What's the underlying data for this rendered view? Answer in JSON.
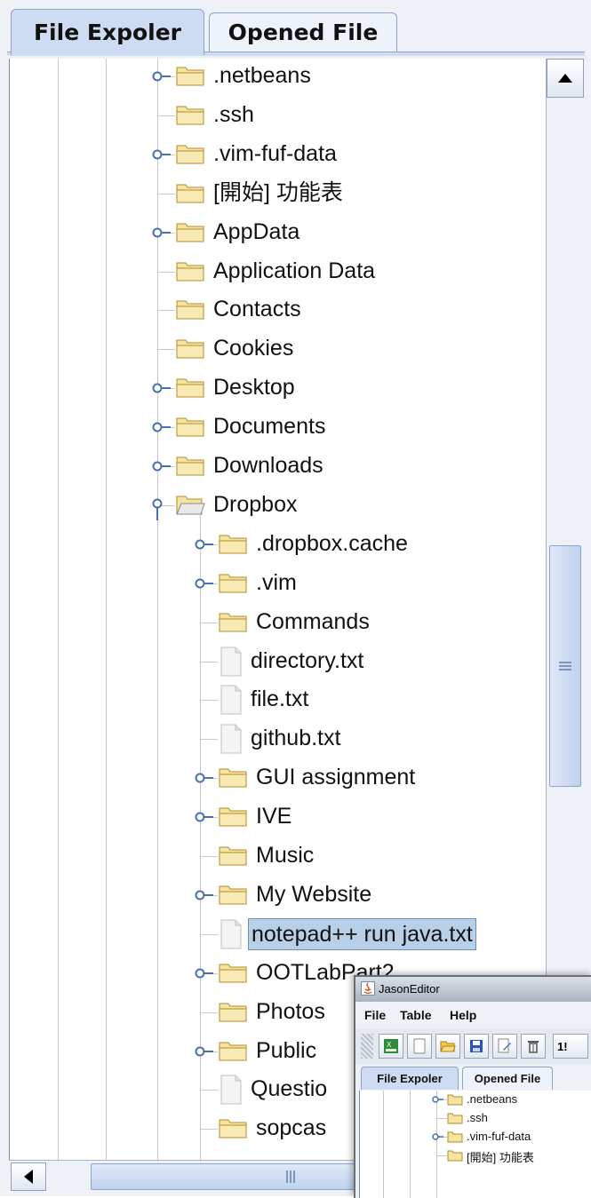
{
  "tabs": [
    {
      "label": "File Expoler",
      "active": true
    },
    {
      "label": "Opened File",
      "active": false
    }
  ],
  "tree": {
    "selected_index": 22,
    "items": [
      {
        "label": ".netbeans",
        "icon": "folder-icon",
        "expandable": true,
        "expanded": false,
        "level": 1
      },
      {
        "label": ".ssh",
        "icon": "folder-icon",
        "expandable": false,
        "level": 1
      },
      {
        "label": ".vim-fuf-data",
        "icon": "folder-icon",
        "expandable": true,
        "expanded": false,
        "level": 1
      },
      {
        "label": "[開始] 功能表",
        "icon": "folder-icon",
        "expandable": false,
        "level": 1
      },
      {
        "label": "AppData",
        "icon": "folder-icon",
        "expandable": true,
        "expanded": false,
        "level": 1
      },
      {
        "label": "Application Data",
        "icon": "folder-icon",
        "expandable": false,
        "level": 1
      },
      {
        "label": "Contacts",
        "icon": "folder-icon",
        "expandable": false,
        "level": 1
      },
      {
        "label": "Cookies",
        "icon": "folder-icon",
        "expandable": false,
        "level": 1
      },
      {
        "label": "Desktop",
        "icon": "folder-icon",
        "expandable": true,
        "expanded": false,
        "level": 1
      },
      {
        "label": "Documents",
        "icon": "folder-icon",
        "expandable": true,
        "expanded": false,
        "level": 1
      },
      {
        "label": "Downloads",
        "icon": "folder-icon",
        "expandable": true,
        "expanded": false,
        "level": 1
      },
      {
        "label": "Dropbox",
        "icon": "open-folder-icon",
        "expandable": true,
        "expanded": true,
        "level": 1
      },
      {
        "label": ".dropbox.cache",
        "icon": "folder-icon",
        "expandable": true,
        "expanded": false,
        "level": 2
      },
      {
        "label": ".vim",
        "icon": "folder-icon",
        "expandable": true,
        "expanded": false,
        "level": 2
      },
      {
        "label": "Commands",
        "icon": "folder-icon",
        "expandable": false,
        "level": 2
      },
      {
        "label": "directory.txt",
        "icon": "file-icon",
        "expandable": false,
        "level": 2
      },
      {
        "label": "file.txt",
        "icon": "file-icon",
        "expandable": false,
        "level": 2
      },
      {
        "label": "github.txt",
        "icon": "file-icon",
        "expandable": false,
        "level": 2
      },
      {
        "label": "GUI assignment",
        "icon": "folder-icon",
        "expandable": true,
        "expanded": false,
        "level": 2
      },
      {
        "label": "IVE",
        "icon": "folder-icon",
        "expandable": true,
        "expanded": false,
        "level": 2
      },
      {
        "label": "Music",
        "icon": "folder-icon",
        "expandable": false,
        "level": 2
      },
      {
        "label": "My Website",
        "icon": "folder-icon",
        "expandable": true,
        "expanded": false,
        "level": 2
      },
      {
        "label": "notepad++ run java.txt",
        "icon": "file-icon",
        "expandable": false,
        "level": 2
      },
      {
        "label": "OOTLabPart2",
        "icon": "folder-icon",
        "expandable": true,
        "expanded": false,
        "level": 2
      },
      {
        "label": "Photos",
        "icon": "folder-icon",
        "expandable": false,
        "level": 2
      },
      {
        "label": "Public",
        "icon": "folder-icon",
        "expandable": true,
        "expanded": false,
        "level": 2
      },
      {
        "label": "Questio",
        "icon": "file-icon",
        "expandable": false,
        "level": 2
      },
      {
        "label": "sopcas",
        "icon": "folder-icon",
        "expandable": false,
        "level": 2
      }
    ]
  },
  "overlay": {
    "title": "JasonEditor",
    "menu": [
      "File",
      "Table",
      "Help"
    ],
    "toolbar_icons": [
      "excel-icon",
      "new-file-icon",
      "open-folder-icon",
      "save-icon",
      "edit-icon",
      "trash-icon"
    ],
    "toolbar_clipped_text": "1!",
    "tabs": [
      {
        "label": "File Expoler",
        "active": true
      },
      {
        "label": "Opened File",
        "active": false
      }
    ],
    "tree": [
      {
        "label": ".netbeans",
        "expandable": true
      },
      {
        "label": ".ssh",
        "expandable": false
      },
      {
        "label": ".vim-fuf-data",
        "expandable": true
      },
      {
        "label": "[開始] 功能表",
        "expandable": false
      }
    ]
  },
  "colors": {
    "tab_active": "#cddcf2",
    "selection": "#b8cfe8",
    "folder_fill": "#f4e4a0",
    "folder_stroke": "#b38b2c",
    "tree_line": "#c8c8c8",
    "handle": "#4a6fb3"
  }
}
